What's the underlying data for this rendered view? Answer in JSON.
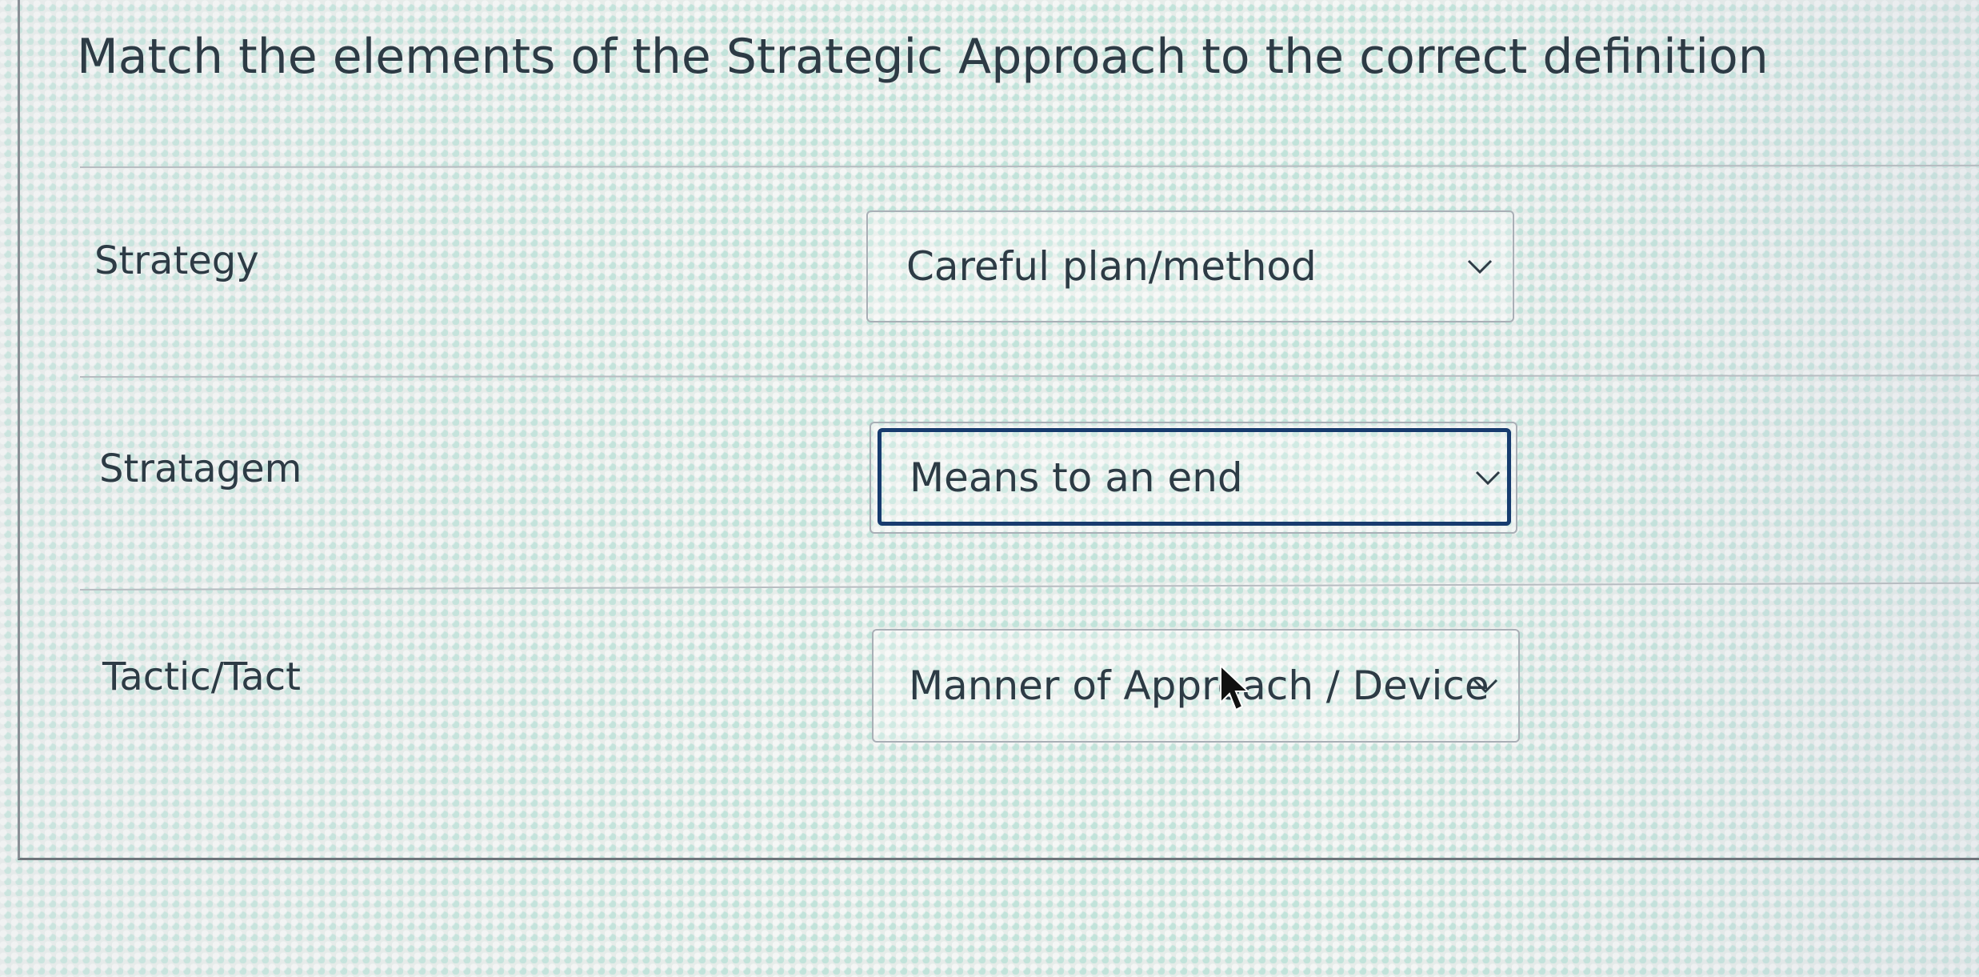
{
  "question": {
    "title": "Match the elements of the Strategic Approach to the correct definition"
  },
  "matches": [
    {
      "term": "Strategy",
      "selected": "Careful plan/method",
      "focused": false
    },
    {
      "term": "Stratagem",
      "selected": "Means to an end",
      "focused": true
    },
    {
      "term": "Tactic/Tact",
      "selected": "Manner of Approach / Device",
      "focused": false
    }
  ],
  "icons": {
    "dropdown": "chevron-down-icon",
    "pointer": "mouse-cursor-icon"
  },
  "colors": {
    "text": "#2d3b45",
    "focus": "#173b6e",
    "border": "#a9afb6"
  }
}
